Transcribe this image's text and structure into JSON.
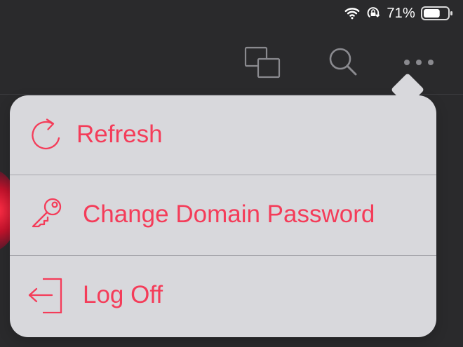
{
  "status_bar": {
    "wifi_icon": "wifi-icon",
    "rotation_lock_icon": "rotation-lock-icon",
    "battery_percent": "71%",
    "battery_icon": "battery-icon",
    "battery_level": 0.71
  },
  "toolbar": {
    "windows_icon": "multitasking-icon",
    "search_icon": "search-icon",
    "more_icon": "more-icon"
  },
  "menu": {
    "accent_color": "#f43c59",
    "items": [
      {
        "icon": "refresh-icon",
        "label": "Refresh"
      },
      {
        "icon": "key-icon",
        "label": "Change Domain Password"
      },
      {
        "icon": "log-off-icon",
        "label": "Log Off"
      }
    ]
  }
}
